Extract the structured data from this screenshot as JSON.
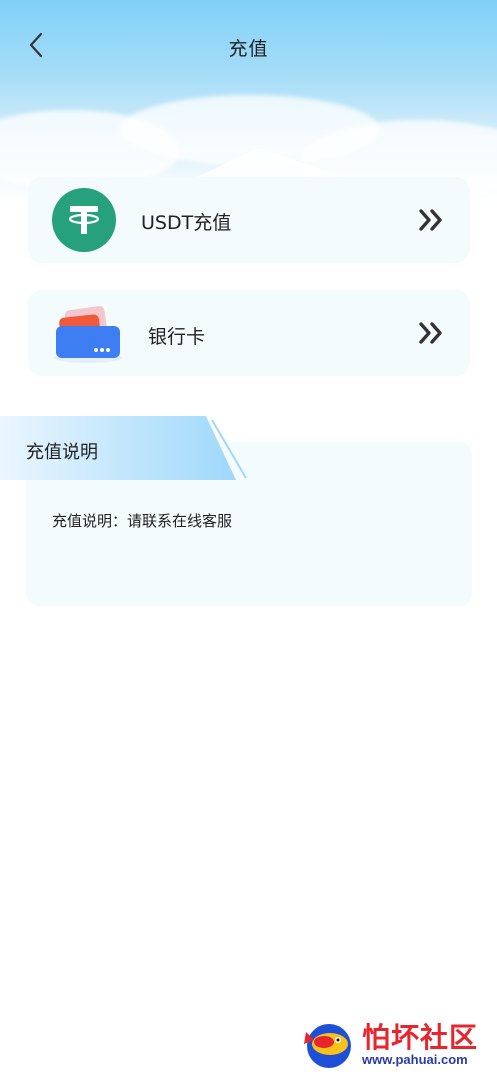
{
  "header": {
    "title": "充值",
    "back_icon": "chevron-left-icon"
  },
  "methods": [
    {
      "label": "USDT充值",
      "icon": "usdt-tether-icon",
      "arrow_icon": "double-chevron-right-icon"
    },
    {
      "label": "银行卡",
      "icon": "bank-card-icon",
      "arrow_icon": "double-chevron-right-icon"
    }
  ],
  "info": {
    "heading": "充值说明",
    "text": "充值说明：请联系在线客服"
  },
  "watermark": {
    "title": "怕坏社区",
    "url": "www.pahuai.com"
  },
  "colors": {
    "usdt_green": "#26a17b",
    "card_bg": "#f3fbfd",
    "header_sky": "#7fd0f8",
    "watermark_red": "#e8242c",
    "watermark_blue": "#2a3aa8"
  }
}
